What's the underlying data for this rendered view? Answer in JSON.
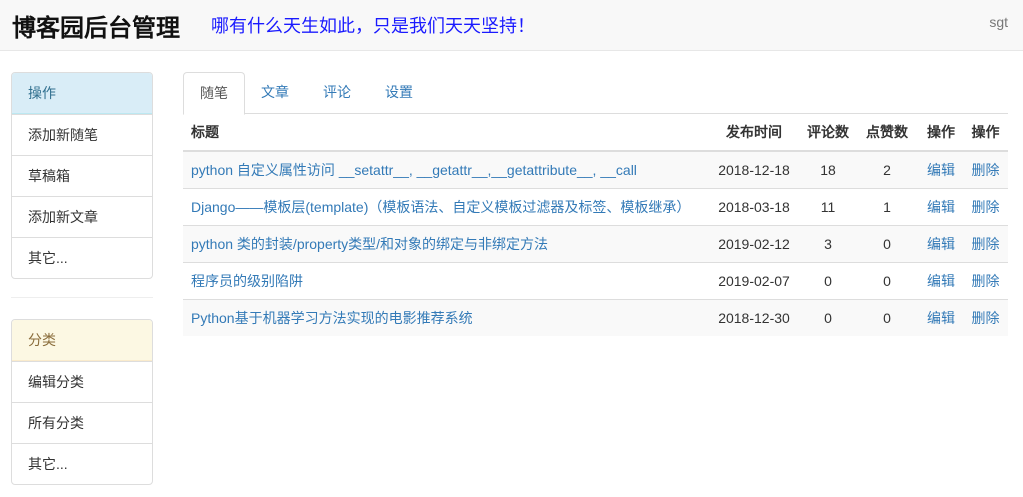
{
  "header": {
    "brand": "博客园后台管理",
    "slogan": "哪有什么天生如此，只是我们天天坚持！",
    "user": "sgt"
  },
  "sidebar": {
    "ops_title": "操作",
    "ops_items": [
      "添加新随笔",
      "草稿箱",
      "添加新文章",
      "其它..."
    ],
    "cat_title": "分类",
    "cat_items": [
      "编辑分类",
      "所有分类",
      "其它..."
    ]
  },
  "tabs": [
    "随笔",
    "文章",
    "评论",
    "设置"
  ],
  "table": {
    "headers": [
      "标题",
      "发布时间",
      "评论数",
      "点赞数",
      "操作",
      "操作"
    ],
    "rows": [
      {
        "title": "python 自定义属性访问 __setattr__, __getattr__,__getattribute__, __call",
        "date": "2018-12-18",
        "comments": "18",
        "likes": "2",
        "edit": "编辑",
        "delete": "删除"
      },
      {
        "title": "Django——模板层(template)（模板语法、自定义模板过滤器及标签、模板继承）",
        "date": "2018-03-18",
        "comments": "11",
        "likes": "1",
        "edit": "编辑",
        "delete": "删除"
      },
      {
        "title": "python 类的封装/property类型/和对象的绑定与非绑定方法",
        "date": "2019-02-12",
        "comments": "3",
        "likes": "0",
        "edit": "编辑",
        "delete": "删除"
      },
      {
        "title": "程序员的级别陷阱",
        "date": "2019-02-07",
        "comments": "0",
        "likes": "0",
        "edit": "编辑",
        "delete": "删除"
      },
      {
        "title": "Python基于机器学习方法实现的电影推荐系统",
        "date": "2018-12-30",
        "comments": "0",
        "likes": "0",
        "edit": "编辑",
        "delete": "删除"
      }
    ]
  }
}
